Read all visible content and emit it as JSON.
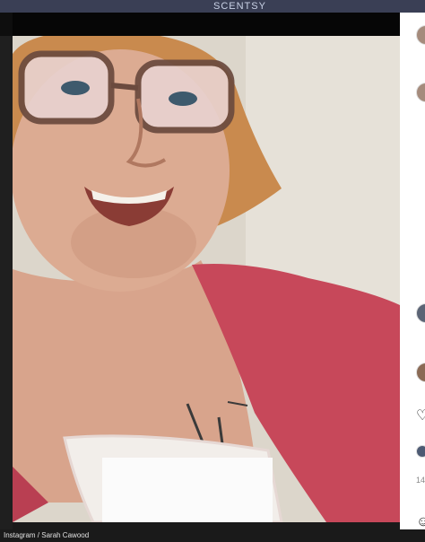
{
  "header": {
    "brand_text": "SCENTSY"
  },
  "post": {
    "image_alt": "Selfie of a smiling woman wearing glasses and a red top, with a bandage on her chest"
  },
  "sidebar": {
    "comment_count_text": "14"
  },
  "footer": {
    "credit": "Instagram / Sarah Cawood"
  }
}
